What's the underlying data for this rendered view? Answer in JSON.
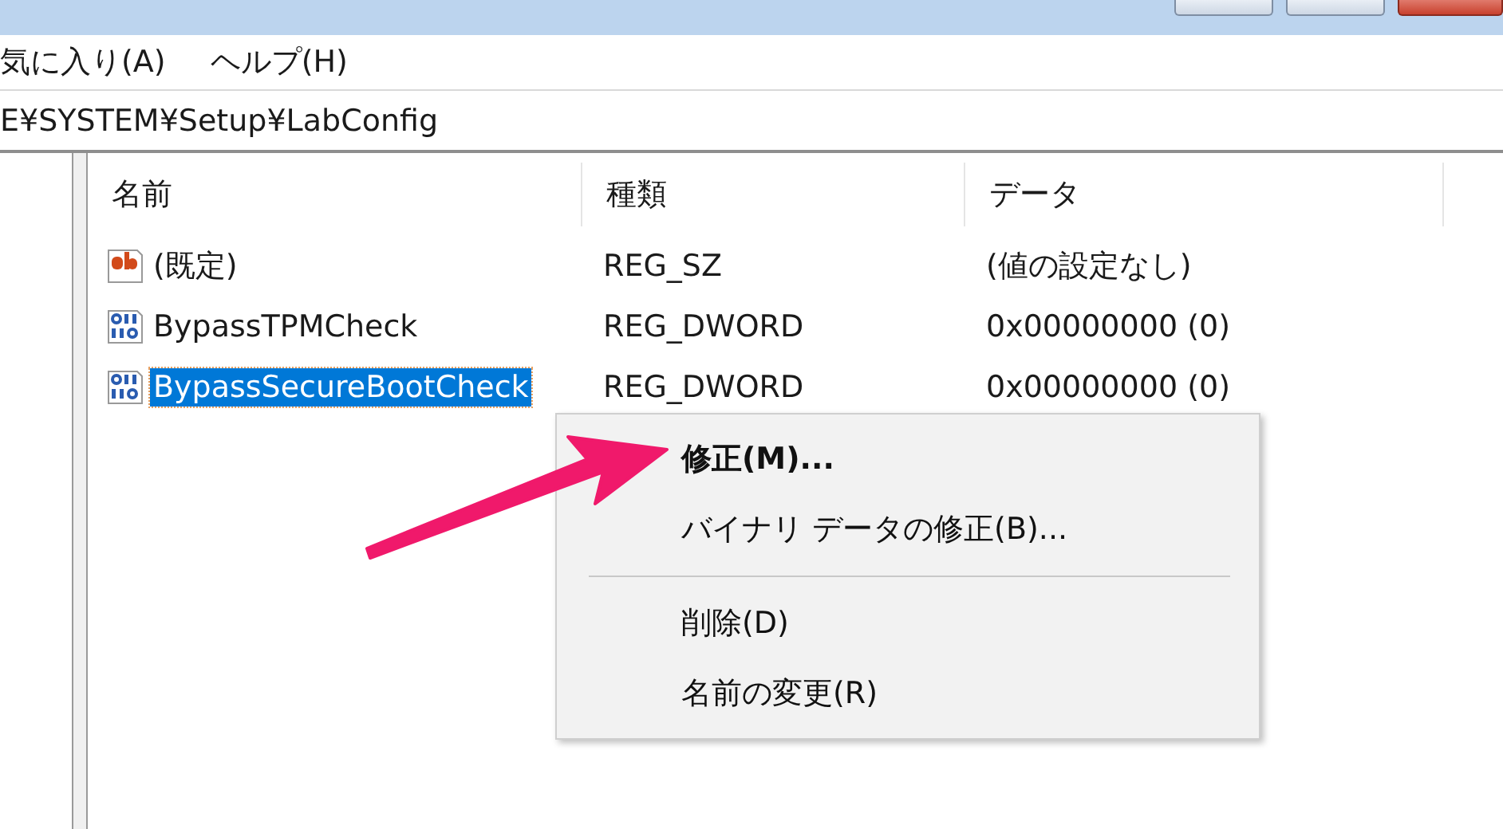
{
  "menu_bar": [
    {
      "label": "気に入り(A)"
    },
    {
      "label": "ヘルプ(H)"
    }
  ],
  "address": "E¥SYSTEM¥Setup¥LabConfig",
  "columns": [
    "名前",
    "種類",
    "データ"
  ],
  "rows": [
    {
      "kind": "string",
      "name": "(既定)",
      "type": "REG_SZ",
      "data": "(値の設定なし)",
      "selected": false
    },
    {
      "kind": "dword",
      "name": "BypassTPMCheck",
      "type": "REG_DWORD",
      "data": "0x00000000 (0)",
      "selected": false
    },
    {
      "kind": "dword",
      "name": "BypassSecureBootCheck",
      "type": "REG_DWORD",
      "data": "0x00000000 (0)",
      "selected": true
    }
  ],
  "context_menu": {
    "items": [
      {
        "kind": "item",
        "label": "修正(M)...",
        "default": true
      },
      {
        "kind": "item",
        "label": "バイナリ データの修正(B)...",
        "default": false
      },
      {
        "kind": "separator"
      },
      {
        "kind": "item",
        "label": "削除(D)",
        "default": false
      },
      {
        "kind": "item",
        "label": "名前の変更(R)",
        "default": false
      }
    ]
  }
}
